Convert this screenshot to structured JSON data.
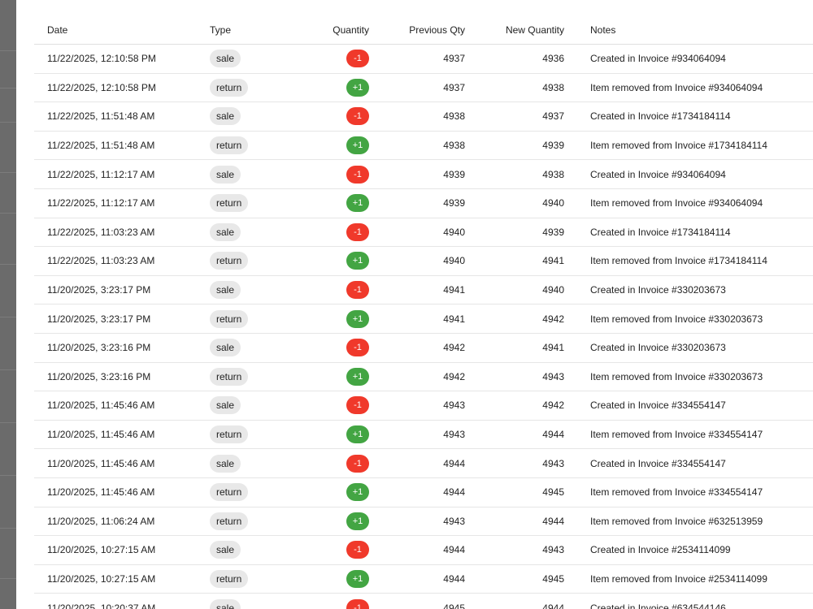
{
  "colors": {
    "sale_badge": "#f0392b",
    "return_badge": "#43a543",
    "type_chip_bg": "#e8e8e8"
  },
  "table": {
    "columns": [
      "Date",
      "Type",
      "Quantity",
      "Previous Qty",
      "New Quantity",
      "Notes"
    ],
    "rows": [
      {
        "date": "11/22/2025, 12:10:58 PM",
        "type": "sale",
        "quantity": "-1",
        "previous": "4937",
        "new": "4936",
        "notes": "Created in Invoice #934064094"
      },
      {
        "date": "11/22/2025, 12:10:58 PM",
        "type": "return",
        "quantity": "+1",
        "previous": "4937",
        "new": "4938",
        "notes": "Item removed from Invoice #934064094"
      },
      {
        "date": "11/22/2025, 11:51:48 AM",
        "type": "sale",
        "quantity": "-1",
        "previous": "4938",
        "new": "4937",
        "notes": "Created in Invoice #1734184114"
      },
      {
        "date": "11/22/2025, 11:51:48 AM",
        "type": "return",
        "quantity": "+1",
        "previous": "4938",
        "new": "4939",
        "notes": "Item removed from Invoice #1734184114"
      },
      {
        "date": "11/22/2025, 11:12:17 AM",
        "type": "sale",
        "quantity": "-1",
        "previous": "4939",
        "new": "4938",
        "notes": "Created in Invoice #934064094"
      },
      {
        "date": "11/22/2025, 11:12:17 AM",
        "type": "return",
        "quantity": "+1",
        "previous": "4939",
        "new": "4940",
        "notes": "Item removed from Invoice #934064094"
      },
      {
        "date": "11/22/2025, 11:03:23 AM",
        "type": "sale",
        "quantity": "-1",
        "previous": "4940",
        "new": "4939",
        "notes": "Created in Invoice #1734184114"
      },
      {
        "date": "11/22/2025, 11:03:23 AM",
        "type": "return",
        "quantity": "+1",
        "previous": "4940",
        "new": "4941",
        "notes": "Item removed from Invoice #1734184114"
      },
      {
        "date": "11/20/2025, 3:23:17 PM",
        "type": "sale",
        "quantity": "-1",
        "previous": "4941",
        "new": "4940",
        "notes": "Created in Invoice #330203673"
      },
      {
        "date": "11/20/2025, 3:23:17 PM",
        "type": "return",
        "quantity": "+1",
        "previous": "4941",
        "new": "4942",
        "notes": "Item removed from Invoice #330203673"
      },
      {
        "date": "11/20/2025, 3:23:16 PM",
        "type": "sale",
        "quantity": "-1",
        "previous": "4942",
        "new": "4941",
        "notes": "Created in Invoice #330203673"
      },
      {
        "date": "11/20/2025, 3:23:16 PM",
        "type": "return",
        "quantity": "+1",
        "previous": "4942",
        "new": "4943",
        "notes": "Item removed from Invoice #330203673"
      },
      {
        "date": "11/20/2025, 11:45:46 AM",
        "type": "sale",
        "quantity": "-1",
        "previous": "4943",
        "new": "4942",
        "notes": "Created in Invoice #334554147"
      },
      {
        "date": "11/20/2025, 11:45:46 AM",
        "type": "return",
        "quantity": "+1",
        "previous": "4943",
        "new": "4944",
        "notes": "Item removed from Invoice #334554147"
      },
      {
        "date": "11/20/2025, 11:45:46 AM",
        "type": "sale",
        "quantity": "-1",
        "previous": "4944",
        "new": "4943",
        "notes": "Created in Invoice #334554147"
      },
      {
        "date": "11/20/2025, 11:45:46 AM",
        "type": "return",
        "quantity": "+1",
        "previous": "4944",
        "new": "4945",
        "notes": "Item removed from Invoice #334554147"
      },
      {
        "date": "11/20/2025, 11:06:24 AM",
        "type": "return",
        "quantity": "+1",
        "previous": "4943",
        "new": "4944",
        "notes": "Item removed from Invoice #632513959"
      },
      {
        "date": "11/20/2025, 10:27:15 AM",
        "type": "sale",
        "quantity": "-1",
        "previous": "4944",
        "new": "4943",
        "notes": "Created in Invoice #2534114099"
      },
      {
        "date": "11/20/2025, 10:27:15 AM",
        "type": "return",
        "quantity": "+1",
        "previous": "4944",
        "new": "4945",
        "notes": "Item removed from Invoice #2534114099"
      },
      {
        "date": "11/20/2025, 10:20:37 AM",
        "type": "sale",
        "quantity": "-1",
        "previous": "4945",
        "new": "4944",
        "notes": "Created in Invoice #634544146"
      }
    ]
  }
}
